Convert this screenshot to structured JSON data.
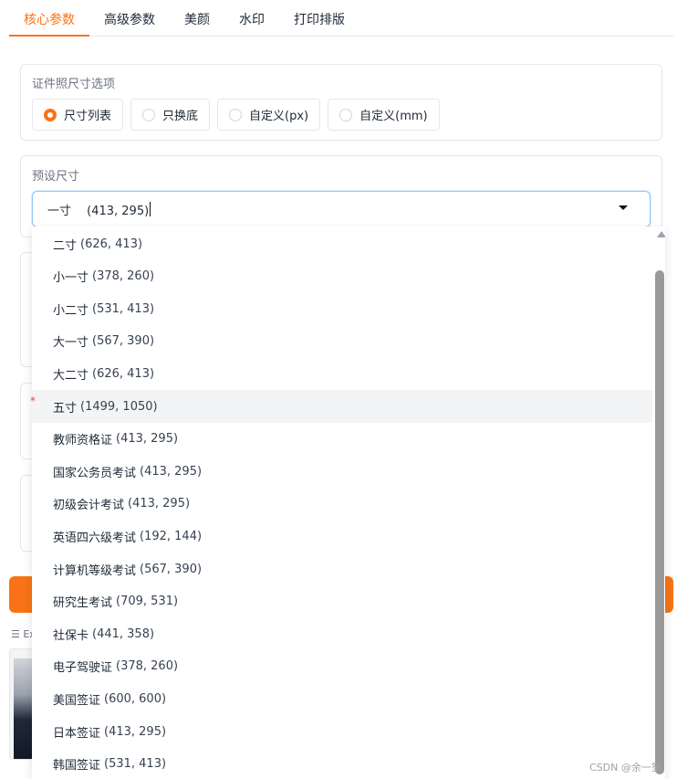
{
  "tabs": [
    "核心参数",
    "高级参数",
    "美颜",
    "水印",
    "打印排版"
  ],
  "size_options": {
    "label": "证件照尺寸选项",
    "options": [
      "尺寸列表",
      "只换底",
      "自定义(px)",
      "自定义(mm)"
    ],
    "selected_index": 0
  },
  "preset": {
    "label": "预设尺寸",
    "value": "一寸　 (413, 295)"
  },
  "dropdown": {
    "items": [
      {
        "name": "二寸",
        "dims": "(626, 413)"
      },
      {
        "name": "小一寸",
        "dims": "(378, 260)"
      },
      {
        "name": "小二寸",
        "dims": "(531, 413)"
      },
      {
        "name": "大一寸",
        "dims": "(567, 390)"
      },
      {
        "name": "大二寸",
        "dims": "(626, 413)"
      },
      {
        "name": "五寸",
        "dims": "(1499, 1050)"
      },
      {
        "name": "教师资格证",
        "dims": "(413, 295)"
      },
      {
        "name": "国家公务员考试",
        "dims": "(413, 295)"
      },
      {
        "name": "初级会计考试",
        "dims": "(413, 295)"
      },
      {
        "name": "英语四六级考试",
        "dims": "(192, 144)"
      },
      {
        "name": "计算机等级考试",
        "dims": "(567, 390)"
      },
      {
        "name": "研究生考试",
        "dims": "(709, 531)"
      },
      {
        "name": "社保卡",
        "dims": "(441, 358)"
      },
      {
        "name": "电子驾驶证",
        "dims": "(378, 260)"
      },
      {
        "name": "美国签证",
        "dims": "(600, 600)"
      },
      {
        "name": "日本签证",
        "dims": "(413, 295)"
      },
      {
        "name": "韩国签证",
        "dims": "(531, 413)"
      }
    ],
    "hover_index": 5
  },
  "examples_label": "☰ Ex",
  "watermark": "CSDN @余一笙",
  "colors": {
    "accent": "#f97316",
    "focus_border": "#93c5fd"
  }
}
